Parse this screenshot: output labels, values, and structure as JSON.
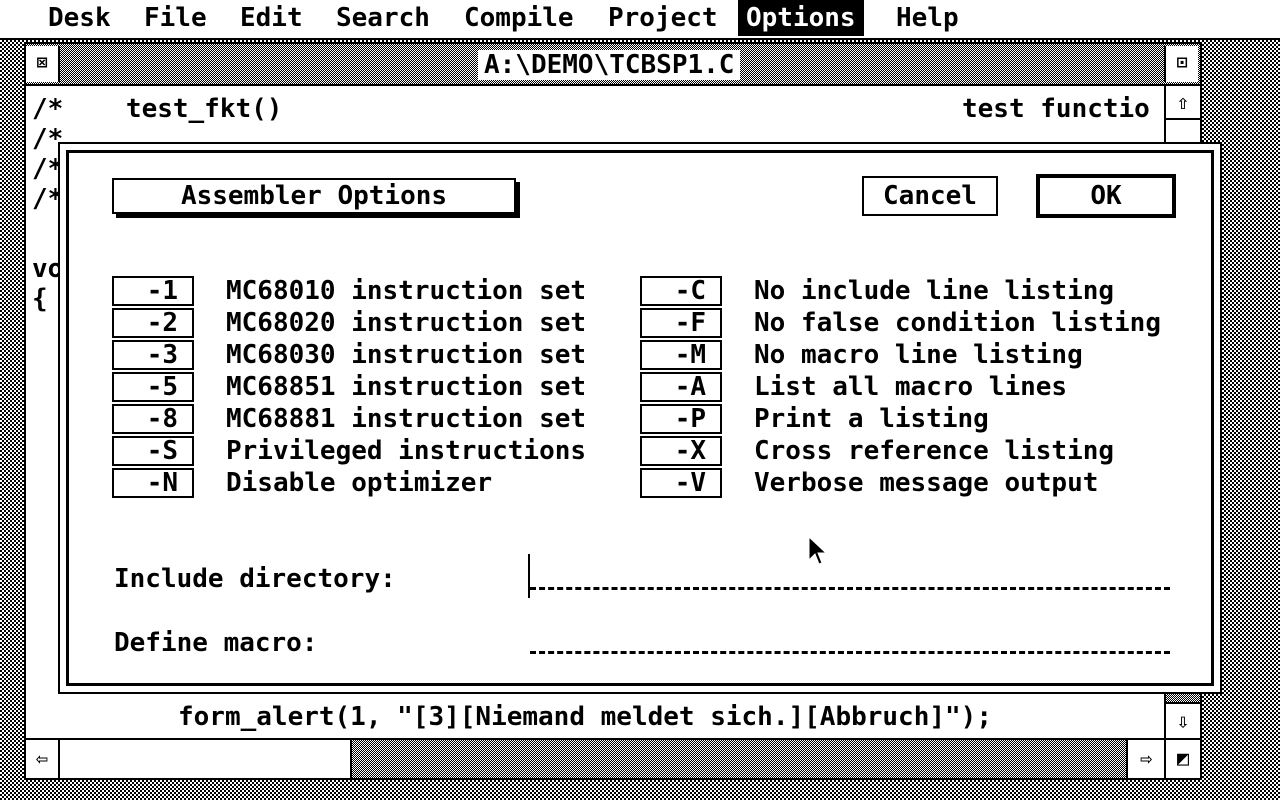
{
  "menubar": {
    "items": [
      "Desk",
      "File",
      "Edit",
      "Search",
      "Compile",
      "Project",
      "Options",
      "Help"
    ],
    "active": "Options"
  },
  "window": {
    "title": "A:\\DEMO\\TCBSP1.C",
    "code_lines": [
      "/*    test_fkt()",
      "/*",
      "/*",
      "/*",
      "vo",
      "{"
    ],
    "code_right_text": "test functio",
    "code_bottom_line": "form_alert(1, \"[3][Niemand meldet sich.][Abbruch]\");"
  },
  "dialog": {
    "title": "Assembler Options",
    "cancel_label": "Cancel",
    "ok_label": "OK",
    "left_options": [
      {
        "key": "-1",
        "label": "MC68010 instruction set"
      },
      {
        "key": "-2",
        "label": "MC68020 instruction set"
      },
      {
        "key": "-3",
        "label": "MC68030 instruction set"
      },
      {
        "key": "-5",
        "label": "MC68851 instruction set"
      },
      {
        "key": "-8",
        "label": "MC68881 instruction set"
      },
      {
        "key": "-S",
        "label": "Privileged instructions"
      },
      {
        "key": "-N",
        "label": "Disable optimizer"
      }
    ],
    "right_options": [
      {
        "key": "-C",
        "label": "No include line listing"
      },
      {
        "key": "-F",
        "label": "No false condition listing"
      },
      {
        "key": "-M",
        "label": "No macro line listing"
      },
      {
        "key": "-A",
        "label": "List all macro lines"
      },
      {
        "key": "-P",
        "label": "Print a listing"
      },
      {
        "key": "-X",
        "label": "Cross reference listing"
      },
      {
        "key": "-V",
        "label": "Verbose message output"
      }
    ],
    "include_dir_label": "Include directory:",
    "include_dir_value": "",
    "define_macro_label": "Define macro:",
    "define_macro_value": ""
  },
  "icons": {
    "close": "close-icon",
    "fuller": "fuller-icon",
    "up": "arrow-up-icon",
    "down": "arrow-down-icon",
    "left": "arrow-left-icon",
    "right": "arrow-right-icon",
    "size": "resize-icon",
    "pointer": "mouse-pointer-icon"
  }
}
